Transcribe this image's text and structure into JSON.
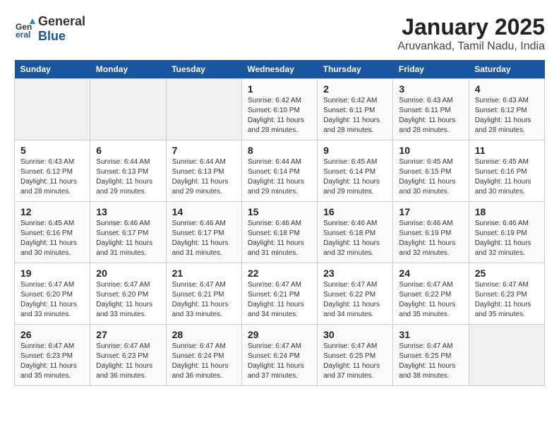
{
  "header": {
    "logo_general": "General",
    "logo_blue": "Blue",
    "title": "January 2025",
    "subtitle": "Aruvankad, Tamil Nadu, India"
  },
  "days_of_week": [
    "Sunday",
    "Monday",
    "Tuesday",
    "Wednesday",
    "Thursday",
    "Friday",
    "Saturday"
  ],
  "weeks": [
    [
      {
        "day": "",
        "info": ""
      },
      {
        "day": "",
        "info": ""
      },
      {
        "day": "",
        "info": ""
      },
      {
        "day": "1",
        "info": "Sunrise: 6:42 AM\nSunset: 6:10 PM\nDaylight: 11 hours\nand 28 minutes."
      },
      {
        "day": "2",
        "info": "Sunrise: 6:42 AM\nSunset: 6:11 PM\nDaylight: 11 hours\nand 28 minutes."
      },
      {
        "day": "3",
        "info": "Sunrise: 6:43 AM\nSunset: 6:11 PM\nDaylight: 11 hours\nand 28 minutes."
      },
      {
        "day": "4",
        "info": "Sunrise: 6:43 AM\nSunset: 6:12 PM\nDaylight: 11 hours\nand 28 minutes."
      }
    ],
    [
      {
        "day": "5",
        "info": "Sunrise: 6:43 AM\nSunset: 6:12 PM\nDaylight: 11 hours\nand 28 minutes."
      },
      {
        "day": "6",
        "info": "Sunrise: 6:44 AM\nSunset: 6:13 PM\nDaylight: 11 hours\nand 29 minutes."
      },
      {
        "day": "7",
        "info": "Sunrise: 6:44 AM\nSunset: 6:13 PM\nDaylight: 11 hours\nand 29 minutes."
      },
      {
        "day": "8",
        "info": "Sunrise: 6:44 AM\nSunset: 6:14 PM\nDaylight: 11 hours\nand 29 minutes."
      },
      {
        "day": "9",
        "info": "Sunrise: 6:45 AM\nSunset: 6:14 PM\nDaylight: 11 hours\nand 29 minutes."
      },
      {
        "day": "10",
        "info": "Sunrise: 6:45 AM\nSunset: 6:15 PM\nDaylight: 11 hours\nand 30 minutes."
      },
      {
        "day": "11",
        "info": "Sunrise: 6:45 AM\nSunset: 6:16 PM\nDaylight: 11 hours\nand 30 minutes."
      }
    ],
    [
      {
        "day": "12",
        "info": "Sunrise: 6:45 AM\nSunset: 6:16 PM\nDaylight: 11 hours\nand 30 minutes."
      },
      {
        "day": "13",
        "info": "Sunrise: 6:46 AM\nSunset: 6:17 PM\nDaylight: 11 hours\nand 31 minutes."
      },
      {
        "day": "14",
        "info": "Sunrise: 6:46 AM\nSunset: 6:17 PM\nDaylight: 11 hours\nand 31 minutes."
      },
      {
        "day": "15",
        "info": "Sunrise: 6:46 AM\nSunset: 6:18 PM\nDaylight: 11 hours\nand 31 minutes."
      },
      {
        "day": "16",
        "info": "Sunrise: 6:46 AM\nSunset: 6:18 PM\nDaylight: 11 hours\nand 32 minutes."
      },
      {
        "day": "17",
        "info": "Sunrise: 6:46 AM\nSunset: 6:19 PM\nDaylight: 11 hours\nand 32 minutes."
      },
      {
        "day": "18",
        "info": "Sunrise: 6:46 AM\nSunset: 6:19 PM\nDaylight: 11 hours\nand 32 minutes."
      }
    ],
    [
      {
        "day": "19",
        "info": "Sunrise: 6:47 AM\nSunset: 6:20 PM\nDaylight: 11 hours\nand 33 minutes."
      },
      {
        "day": "20",
        "info": "Sunrise: 6:47 AM\nSunset: 6:20 PM\nDaylight: 11 hours\nand 33 minutes."
      },
      {
        "day": "21",
        "info": "Sunrise: 6:47 AM\nSunset: 6:21 PM\nDaylight: 11 hours\nand 33 minutes."
      },
      {
        "day": "22",
        "info": "Sunrise: 6:47 AM\nSunset: 6:21 PM\nDaylight: 11 hours\nand 34 minutes."
      },
      {
        "day": "23",
        "info": "Sunrise: 6:47 AM\nSunset: 6:22 PM\nDaylight: 11 hours\nand 34 minutes."
      },
      {
        "day": "24",
        "info": "Sunrise: 6:47 AM\nSunset: 6:22 PM\nDaylight: 11 hours\nand 35 minutes."
      },
      {
        "day": "25",
        "info": "Sunrise: 6:47 AM\nSunset: 6:23 PM\nDaylight: 11 hours\nand 35 minutes."
      }
    ],
    [
      {
        "day": "26",
        "info": "Sunrise: 6:47 AM\nSunset: 6:23 PM\nDaylight: 11 hours\nand 35 minutes."
      },
      {
        "day": "27",
        "info": "Sunrise: 6:47 AM\nSunset: 6:23 PM\nDaylight: 11 hours\nand 36 minutes."
      },
      {
        "day": "28",
        "info": "Sunrise: 6:47 AM\nSunset: 6:24 PM\nDaylight: 11 hours\nand 36 minutes."
      },
      {
        "day": "29",
        "info": "Sunrise: 6:47 AM\nSunset: 6:24 PM\nDaylight: 11 hours\nand 37 minutes."
      },
      {
        "day": "30",
        "info": "Sunrise: 6:47 AM\nSunset: 6:25 PM\nDaylight: 11 hours\nand 37 minutes."
      },
      {
        "day": "31",
        "info": "Sunrise: 6:47 AM\nSunset: 6:25 PM\nDaylight: 11 hours\nand 38 minutes."
      },
      {
        "day": "",
        "info": ""
      }
    ]
  ]
}
